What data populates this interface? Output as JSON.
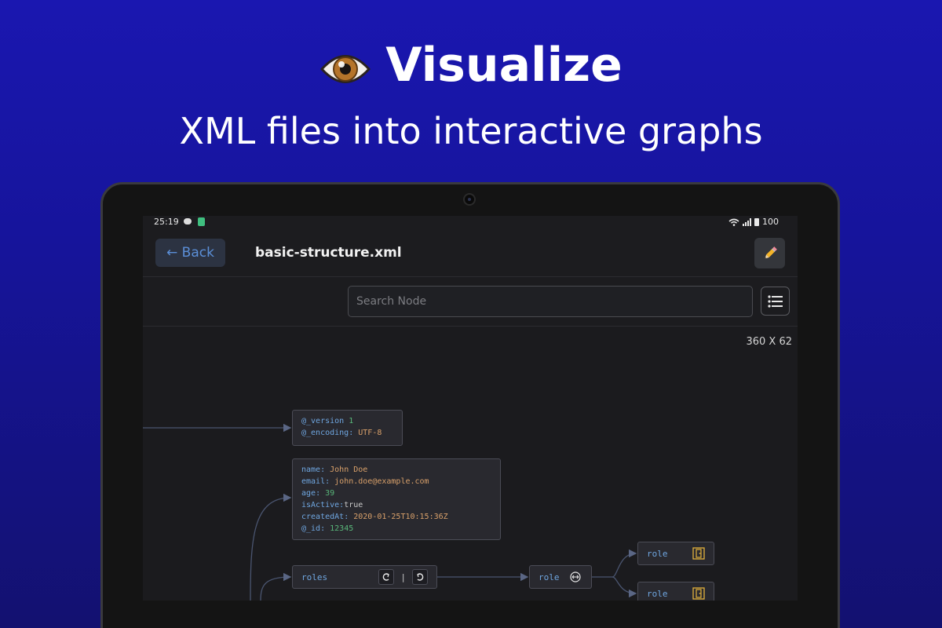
{
  "hero": {
    "title": "Visualize",
    "subtitle": "XML files into interactive graphs",
    "icon": "eye-icon"
  },
  "status": {
    "time": "25:19",
    "battery": "100"
  },
  "appbar": {
    "back_label": "← Back",
    "file_title": "basic-structure.xml",
    "edit_icon": "pencil-icon"
  },
  "search": {
    "placeholder": "Search Node",
    "menu_icon": "list-icon"
  },
  "canvas": {
    "size_label": "360 X 62",
    "declaration_node": [
      {
        "key": "@_version",
        "sep": " ",
        "value": "1",
        "type": "num"
      },
      {
        "key": "@_encoding",
        "sep": ": ",
        "value": "UTF-8",
        "type": "str"
      }
    ],
    "user_node": [
      {
        "key": "name",
        "sep": ": ",
        "value": "John Doe",
        "type": "str"
      },
      {
        "key": "email",
        "sep": ": ",
        "value": "john.doe@example.com",
        "type": "str"
      },
      {
        "key": "age",
        "sep": ": ",
        "value": "39",
        "type": "num"
      },
      {
        "key": "isActive",
        "sep": ":",
        "value": "true",
        "type": "bool"
      },
      {
        "key": "createdAt",
        "sep": ": ",
        "value": "2020-01-25T10:15:36Z",
        "type": "str"
      },
      {
        "key": "@_id",
        "sep": ": ",
        "value": "12345",
        "type": "num"
      }
    ],
    "roles_node": {
      "label": "roles",
      "divider": "|"
    },
    "role_node": {
      "label": "role"
    },
    "role_child_1": {
      "label": "role"
    },
    "role_child_2": {
      "label": "role"
    }
  },
  "colors": {
    "background": "#1a17b0",
    "key": "#6fa6e0",
    "number": "#59b77a",
    "string": "#d8a06a",
    "accent": "#5b8fd8"
  }
}
